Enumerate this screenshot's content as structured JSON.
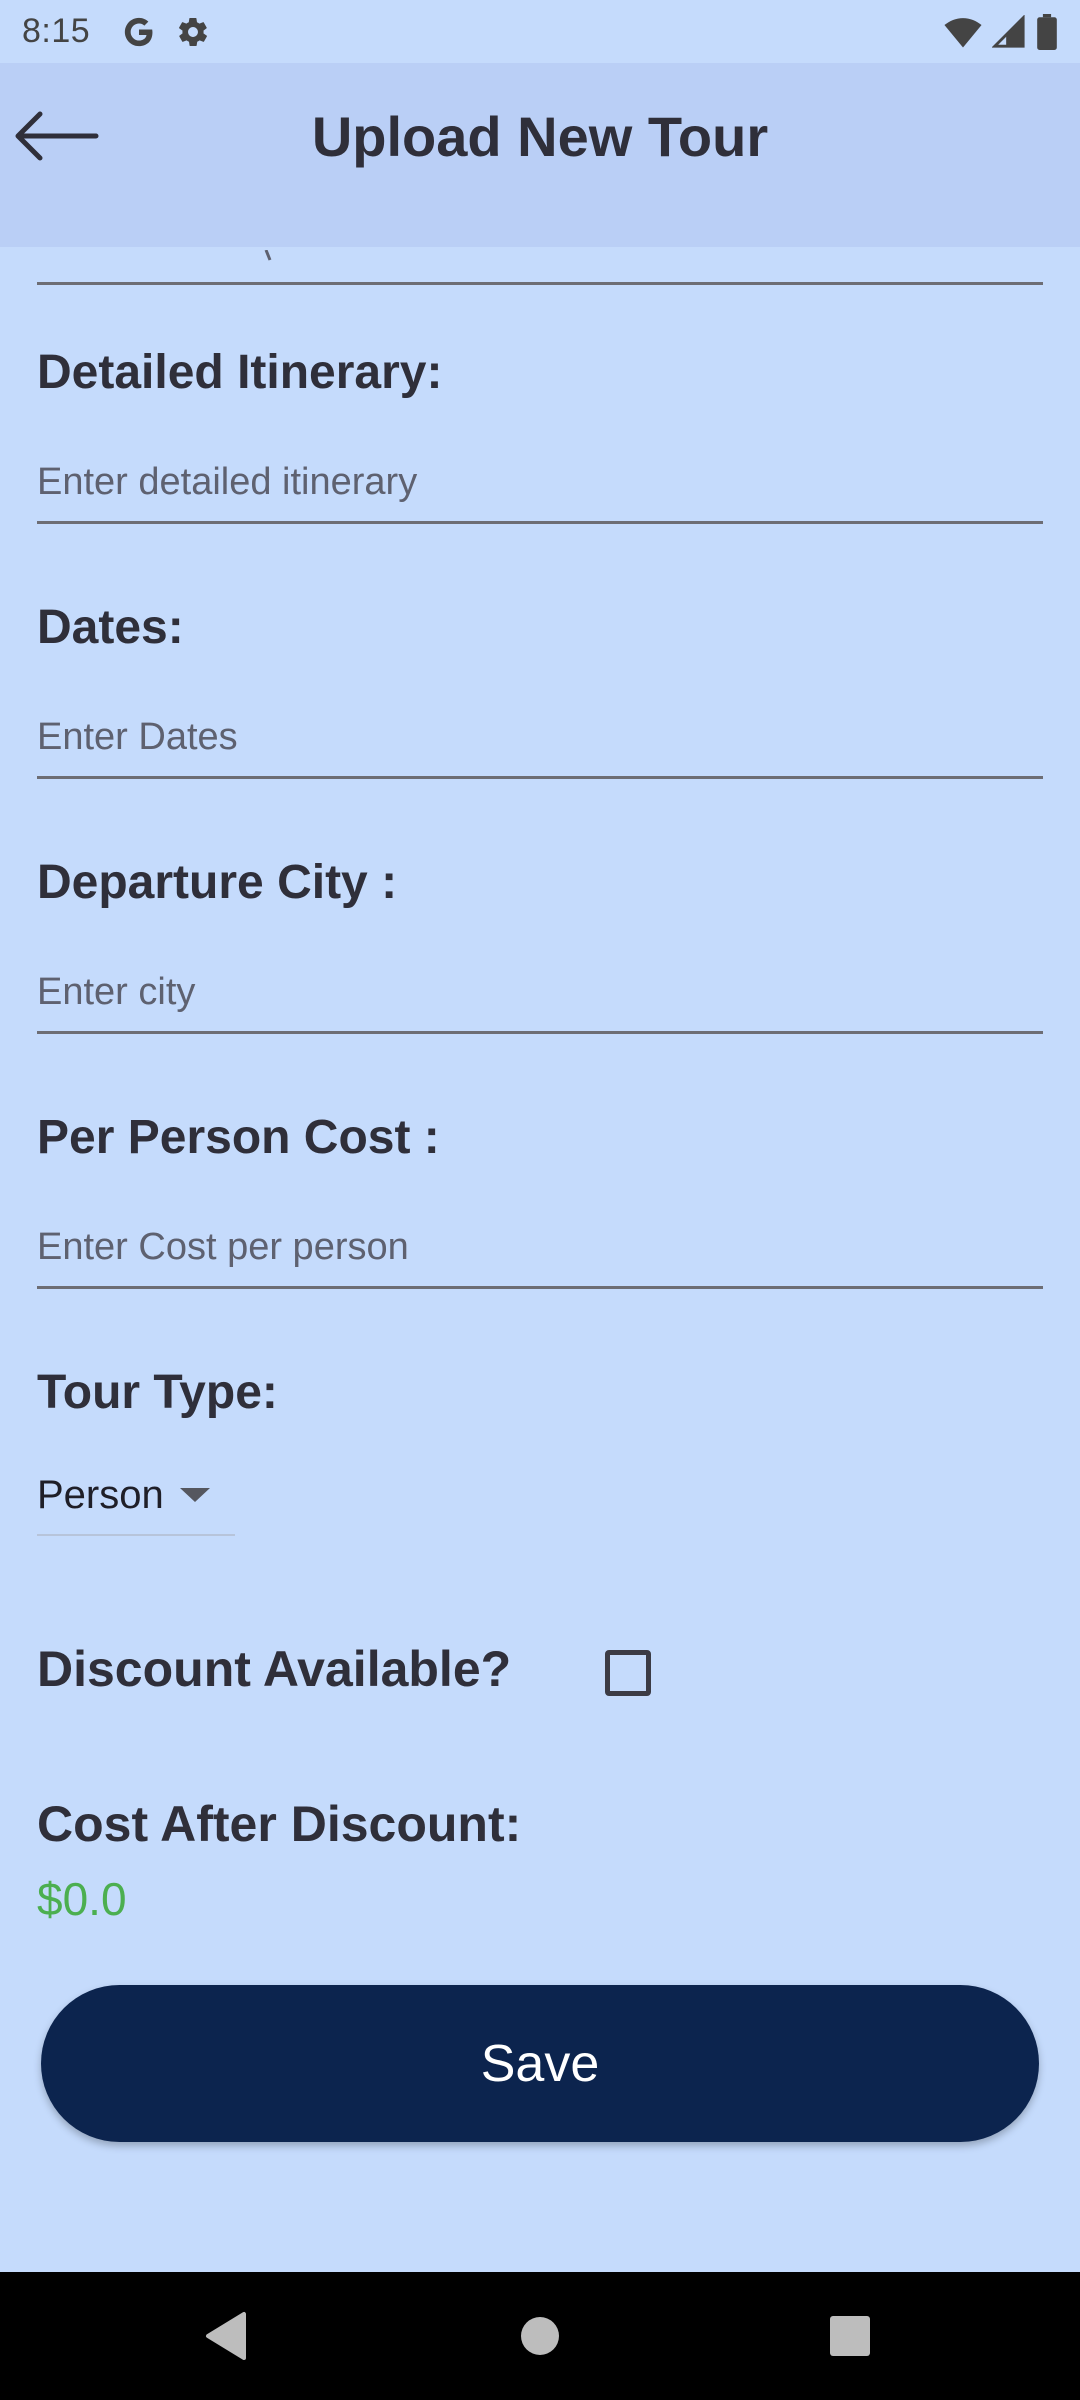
{
  "status_bar": {
    "time": "8:15",
    "icons": [
      "google-icon",
      "settings-gear-icon",
      "wifi-icon",
      "signal-icon",
      "battery-icon"
    ]
  },
  "app_bar": {
    "title": "Upload New Tour",
    "back_icon": "arrow-left-icon"
  },
  "form": {
    "itinerary": {
      "label": "Detailed Itinerary:",
      "placeholder": "Enter detailed itinerary",
      "value": ""
    },
    "dates": {
      "label": "Dates:",
      "placeholder": "Enter Dates",
      "value": ""
    },
    "departure_city": {
      "label": "Departure City :",
      "placeholder": "Enter city",
      "value": ""
    },
    "per_person_cost": {
      "label": "Per Person Cost :",
      "placeholder": "Enter Cost per person",
      "value": ""
    },
    "tour_type": {
      "label": "Tour Type:",
      "selected": "Person",
      "caret_icon": "dropdown-caret-icon"
    },
    "discount": {
      "label": "Discount Available?",
      "checked": false
    },
    "cost_after_discount": {
      "label": "Cost After Discount:",
      "value": "$0.0"
    }
  },
  "save_button": {
    "label": "Save"
  },
  "nav_bar": {
    "icons": [
      "back-triangle-icon",
      "home-circle-icon",
      "recents-square-icon"
    ]
  },
  "colors": {
    "background": "#c5dbfc",
    "app_bar": "#bacff6",
    "primary_button": "#0c244e",
    "discount_value": "#4caf50",
    "text": "#2f2f3a"
  }
}
